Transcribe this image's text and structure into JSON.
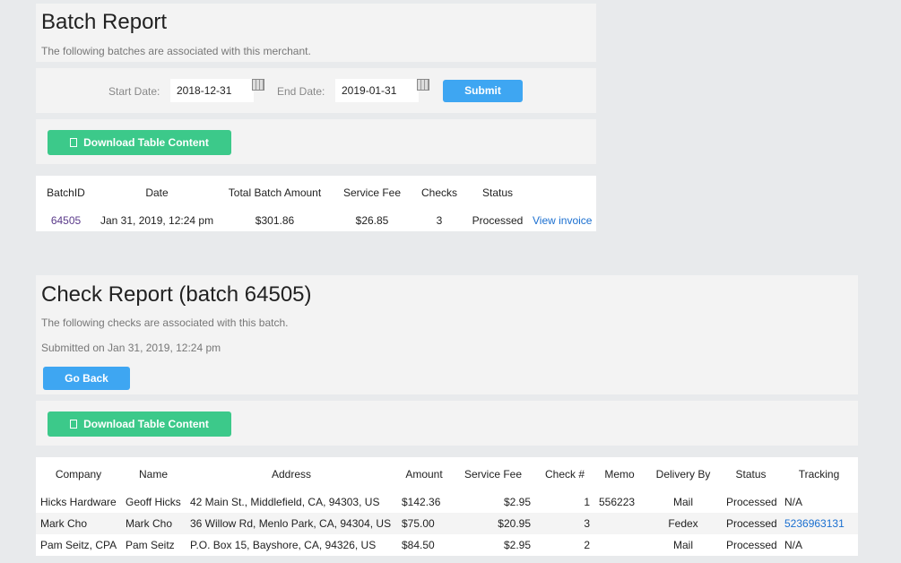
{
  "batch_report": {
    "title": "Batch Report",
    "subtitle": "The following batches are associated with this merchant.",
    "form": {
      "start_label": "Start Date:",
      "start_value": "2018-12-31",
      "end_label": "End Date:",
      "end_value": "2019-01-31",
      "submit": "Submit"
    },
    "download": "Download Table Content",
    "columns": [
      "BatchID",
      "Date",
      "Total Batch Amount",
      "Service Fee",
      "Checks",
      "Status"
    ],
    "rows": [
      {
        "id": "64505",
        "date": "Jan 31, 2019, 12:24 pm",
        "amount": "$301.86",
        "fee": "$26.85",
        "checks": "3",
        "status": "Processed",
        "action": "View invoice"
      }
    ]
  },
  "check_report": {
    "title": "Check Report (batch 64505)",
    "subtitle": "The following checks are associated with this batch.",
    "submitted": "Submitted on Jan 31, 2019, 12:24 pm",
    "go_back": "Go Back",
    "download": "Download Table Content",
    "columns": [
      "Company",
      "Name",
      "Address",
      "Amount",
      "Service Fee",
      "Check #",
      "Memo",
      "Delivery By",
      "Status",
      "Tracking"
    ],
    "rows": [
      {
        "company": "Hicks Hardware",
        "name": "Geoff Hicks",
        "address": "42 Main St., Middlefield, CA, 94303, US",
        "amount": "$142.36",
        "fee": "$2.95",
        "check": "1",
        "memo": "556223",
        "delivery": "Mail",
        "status": "Processed",
        "tracking": "N/A"
      },
      {
        "company": "Mark Cho",
        "name": "Mark Cho",
        "address": "36 Willow Rd, Menlo Park, CA, 94304, US",
        "amount": "$75.00",
        "fee": "$20.95",
        "check": "3",
        "memo": "",
        "delivery": "Fedex",
        "status": "Processed",
        "tracking": "5236963131"
      },
      {
        "company": "Pam Seitz, CPA",
        "name": "Pam Seitz",
        "address": "P.O. Box 15, Bayshore, CA, 94326, US",
        "amount": "$84.50",
        "fee": "$2.95",
        "check": "2",
        "memo": "",
        "delivery": "Mail",
        "status": "Processed",
        "tracking": "N/A"
      }
    ]
  }
}
